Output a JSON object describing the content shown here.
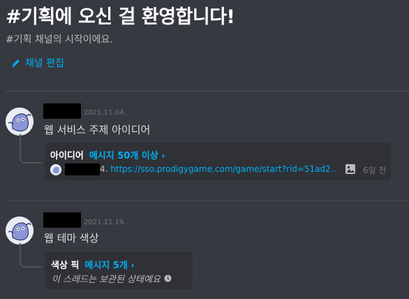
{
  "welcome": {
    "title": "#기획에 오신 걸 환영합니다!",
    "subtitle": "#기획 채널의 시작이에요.",
    "edit_label": "채널 편집"
  },
  "messages": [
    {
      "timestamp": "2021.11.04.",
      "content": "웹 서비스 주제 아이디어",
      "thread": {
        "name": "아이디어",
        "count_label": "메시지 50개 이상 ›",
        "preview_prefix": "4. ",
        "preview_link": "https://sso.prodigygame.com/game/start?rid=51ad2...",
        "time": "6일 전"
      }
    },
    {
      "timestamp": "2021.11.19.",
      "content": "웹 테마 색상",
      "thread": {
        "name": "색상 픽",
        "count_label": "메시지 5개 ›",
        "archived_text": "이 스레드는 보관된 상태예요"
      }
    }
  ],
  "colors": {
    "background": "#36393f",
    "card": "#2f3136",
    "link": "#00aff4",
    "muted": "#72767d"
  },
  "icons": [
    "pencil-icon",
    "image-icon",
    "clock-icon",
    "avatar-ghost"
  ]
}
